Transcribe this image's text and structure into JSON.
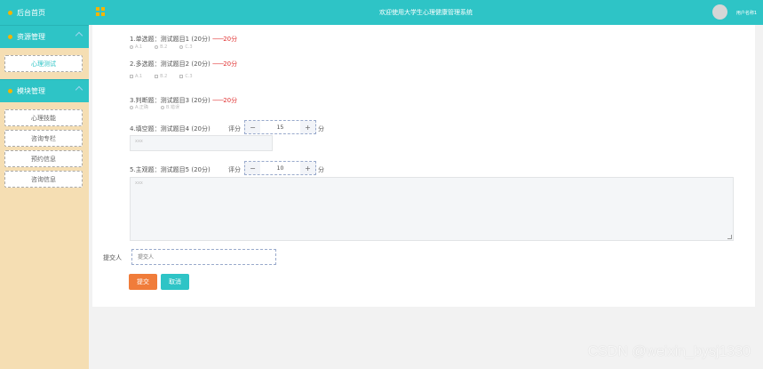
{
  "header": {
    "title": "欢迎使用大学生心理健康管理系统",
    "user": "用户名称1"
  },
  "sidebar": {
    "home": "后台首页",
    "groups": [
      {
        "label": "资源管理",
        "items": [
          "心理测试"
        ]
      },
      {
        "label": "模块管理",
        "items": [
          "心理技能",
          "咨询专栏",
          "预约信息",
          "咨询信息"
        ]
      }
    ]
  },
  "questions": [
    {
      "title": "1.单选题：测试题目1 (20分)",
      "dash": "--------",
      "score": "20分",
      "options": [
        "A.1",
        "B.2",
        "C.3"
      ]
    },
    {
      "title": "2.多选题：测试题目2 (20分)",
      "dash": "--------",
      "score": "20分",
      "options": [
        "A.1",
        "B.2",
        "C.3"
      ]
    },
    {
      "title": "3.判断题：测试题目3 (20分)",
      "dash": "--------",
      "score": "20分",
      "options": [
        "A.正确",
        "B.错误"
      ]
    },
    {
      "title": "4.填空题：测试题目4 (20分)",
      "grade_label": "评分",
      "grade_value": "15",
      "unit": "分",
      "answer_placeholder": "xxx",
      "minus": "−",
      "plus": "+"
    },
    {
      "title": "5.主观题：测试题目5 (20分)",
      "grade_label": "评分",
      "grade_value": "10",
      "unit": "分",
      "answer_placeholder": "xxx",
      "minus": "−",
      "plus": "+"
    }
  ],
  "form": {
    "submitter_label": "提交人",
    "submitter_placeholder": "提交人",
    "submit_label": "提交",
    "cancel_label": "取消"
  },
  "watermark": "CSDN @weixin_bysj1330",
  "colors": {
    "accent": "#2ec4c6",
    "sidebar_bg": "#f5deb3",
    "submit": "#f07c3a",
    "score_red": "#e03030"
  }
}
